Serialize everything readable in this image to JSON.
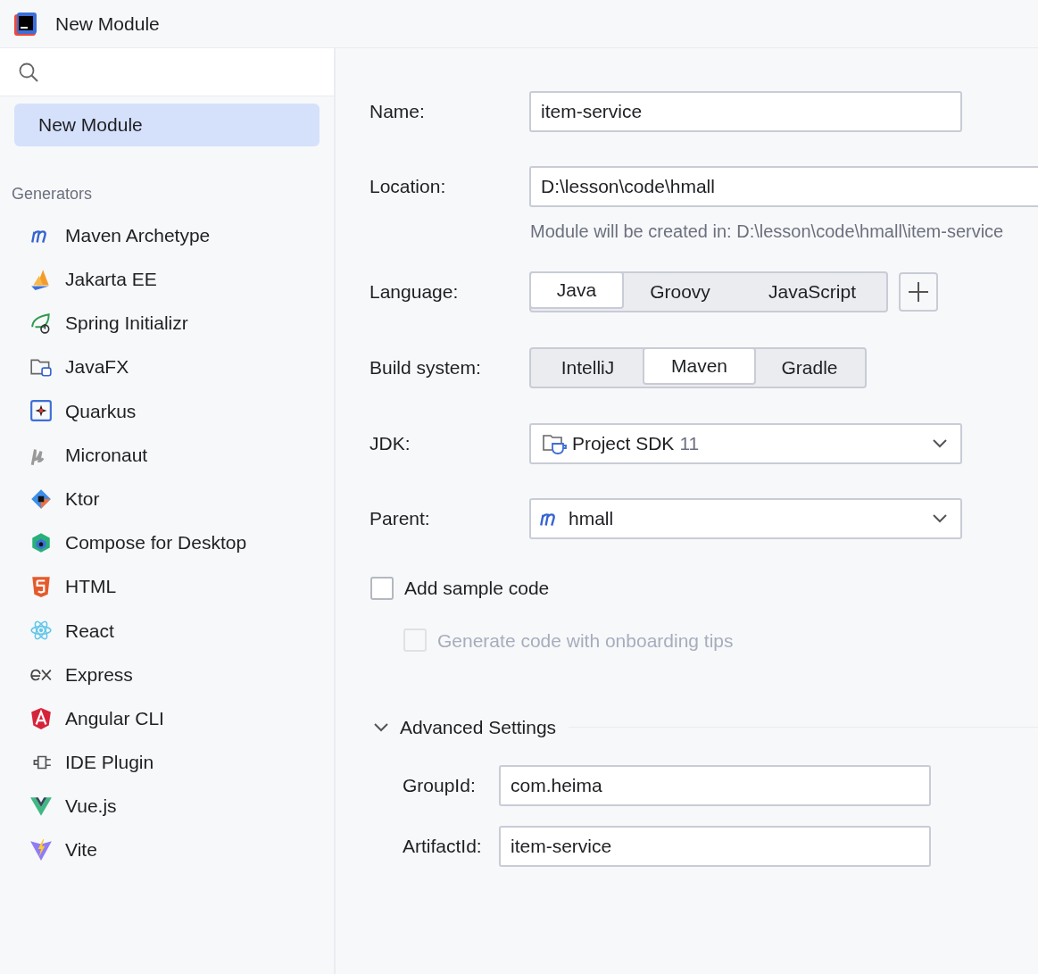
{
  "window": {
    "title": "New Module"
  },
  "sidebar": {
    "items": [
      {
        "label": "New Module",
        "selected": true
      }
    ],
    "section_title": "Generators",
    "generators": [
      {
        "label": "Maven Archetype",
        "selected": false
      },
      {
        "label": "Jakarta EE",
        "selected": false
      },
      {
        "label": "Spring Initializr",
        "selected": false
      },
      {
        "label": "JavaFX",
        "selected": false
      },
      {
        "label": "Quarkus",
        "selected": false
      },
      {
        "label": "Micronaut",
        "selected": false
      },
      {
        "label": "Ktor",
        "selected": false
      },
      {
        "label": "Compose for Desktop",
        "selected": false
      },
      {
        "label": "HTML",
        "selected": false
      },
      {
        "label": "React",
        "selected": false
      },
      {
        "label": "Express",
        "selected": false
      },
      {
        "label": "Angular CLI",
        "selected": false
      },
      {
        "label": "IDE Plugin",
        "selected": false
      },
      {
        "label": "Vue.js",
        "selected": false
      },
      {
        "label": "Vite",
        "selected": false
      }
    ]
  },
  "form": {
    "name": {
      "label": "Name:",
      "value": "item-service"
    },
    "location": {
      "label": "Location:",
      "value": "D:\\lesson\\code\\hmall",
      "hint": "Module will be created in: D:\\lesson\\code\\hmall\\item-service"
    },
    "language": {
      "label": "Language:",
      "options": [
        {
          "label": "Java",
          "selected": true
        },
        {
          "label": "Groovy",
          "selected": false
        },
        {
          "label": "JavaScript",
          "selected": false
        }
      ]
    },
    "build_system": {
      "label": "Build system:",
      "options": [
        {
          "label": "IntelliJ",
          "selected": false
        },
        {
          "label": "Maven",
          "selected": true
        },
        {
          "label": "Gradle",
          "selected": false
        }
      ]
    },
    "jdk": {
      "label": "JDK:",
      "value": "Project SDK",
      "version": "11"
    },
    "parent": {
      "label": "Parent:",
      "value": "hmall"
    },
    "checkboxes": [
      {
        "label": "Add sample code",
        "checked": false,
        "disabled": false
      },
      {
        "label": "Generate code with onboarding tips",
        "checked": false,
        "disabled": true
      }
    ],
    "advanced": {
      "label": "Advanced Settings",
      "expanded": true,
      "group_id": {
        "label": "GroupId:",
        "value": "com.heima"
      },
      "artifact_id": {
        "label": "ArtifactId:",
        "value": "item-service"
      }
    }
  }
}
